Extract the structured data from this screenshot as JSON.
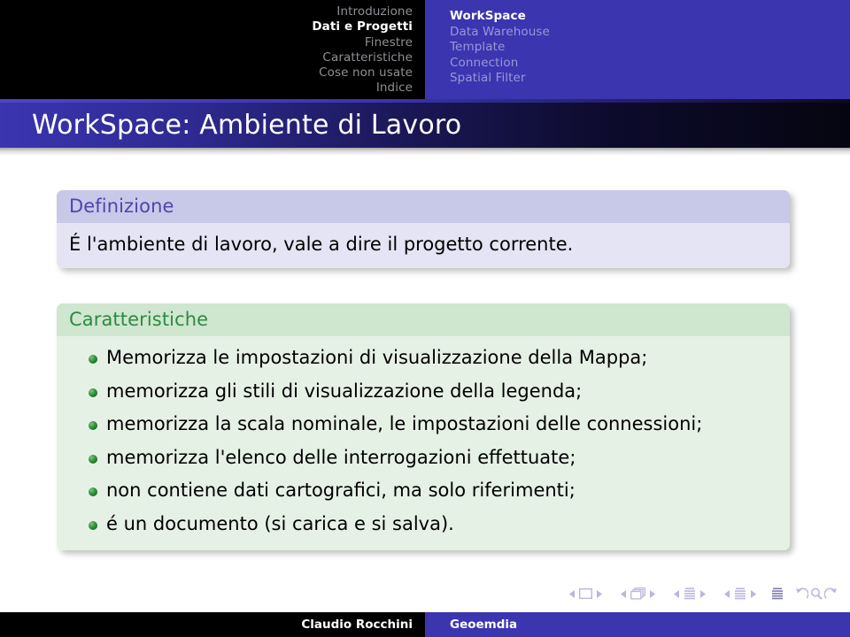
{
  "header": {
    "sections": [
      {
        "label": "Introduzione",
        "active": false
      },
      {
        "label": "Dati e Progetti",
        "active": true
      },
      {
        "label": "Finestre",
        "active": false
      },
      {
        "label": "Caratteristiche",
        "active": false
      },
      {
        "label": "Cose non usate",
        "active": false
      },
      {
        "label": "Indice",
        "active": false
      }
    ],
    "subsections": [
      {
        "label": "WorkSpace",
        "active": true
      },
      {
        "label": "Data Warehouse",
        "active": false
      },
      {
        "label": "Template",
        "active": false
      },
      {
        "label": "Connection",
        "active": false
      },
      {
        "label": "Spatial Filter",
        "active": false
      }
    ]
  },
  "title": {
    "text": "WorkSpace: Ambiente di Lavoro"
  },
  "blocks": {
    "definition": {
      "title": "Definizione",
      "body": "É l'ambiente di lavoro, vale a dire il progetto corrente."
    },
    "features": {
      "title": "Caratteristiche",
      "items": [
        "Memorizza le impostazioni di visualizzazione della Mappa;",
        "memorizza gli stili di visualizzazione della legenda;",
        "memorizza la scala nominale, le impostazioni delle connessioni;",
        "memorizza l'elenco delle interrogazioni effettuate;",
        "non contiene dati cartografici, ma solo riferimenti;",
        "é un documento (si carica e si salva)."
      ]
    }
  },
  "navigation_symbols": [
    {
      "name": "slide",
      "prev": "previous-slide",
      "next": "next-slide"
    },
    {
      "name": "frame",
      "prev": "previous-frame",
      "next": "next-frame"
    },
    {
      "name": "subsection",
      "prev": "previous-subsection",
      "next": "next-subsection"
    },
    {
      "name": "section",
      "prev": "previous-section",
      "next": "next-section"
    },
    {
      "name": "presentation",
      "prev": "",
      "next": ""
    },
    {
      "name": "back-find-forward",
      "prev": "go-back",
      "next": "go-forward"
    }
  ],
  "footer": {
    "author": "Claudio Rocchini",
    "institute": "Geoemdia"
  },
  "colors": {
    "accent_blue": "#3b35b0",
    "title_text": "#ffffff",
    "block_def_title_bg": "#c8c8e8",
    "block_def_title_fg": "#4b46ae",
    "block_def_body_bg": "#e4e4f4",
    "block_ex_title_bg": "#cfe6cf",
    "block_ex_title_fg": "#2d8a40",
    "block_ex_body_bg": "#e6f1e6",
    "nav_inactive": "#8f8f95",
    "nav_sub_inactive": "#9a97d6",
    "navsym": "#b9b7dd"
  }
}
